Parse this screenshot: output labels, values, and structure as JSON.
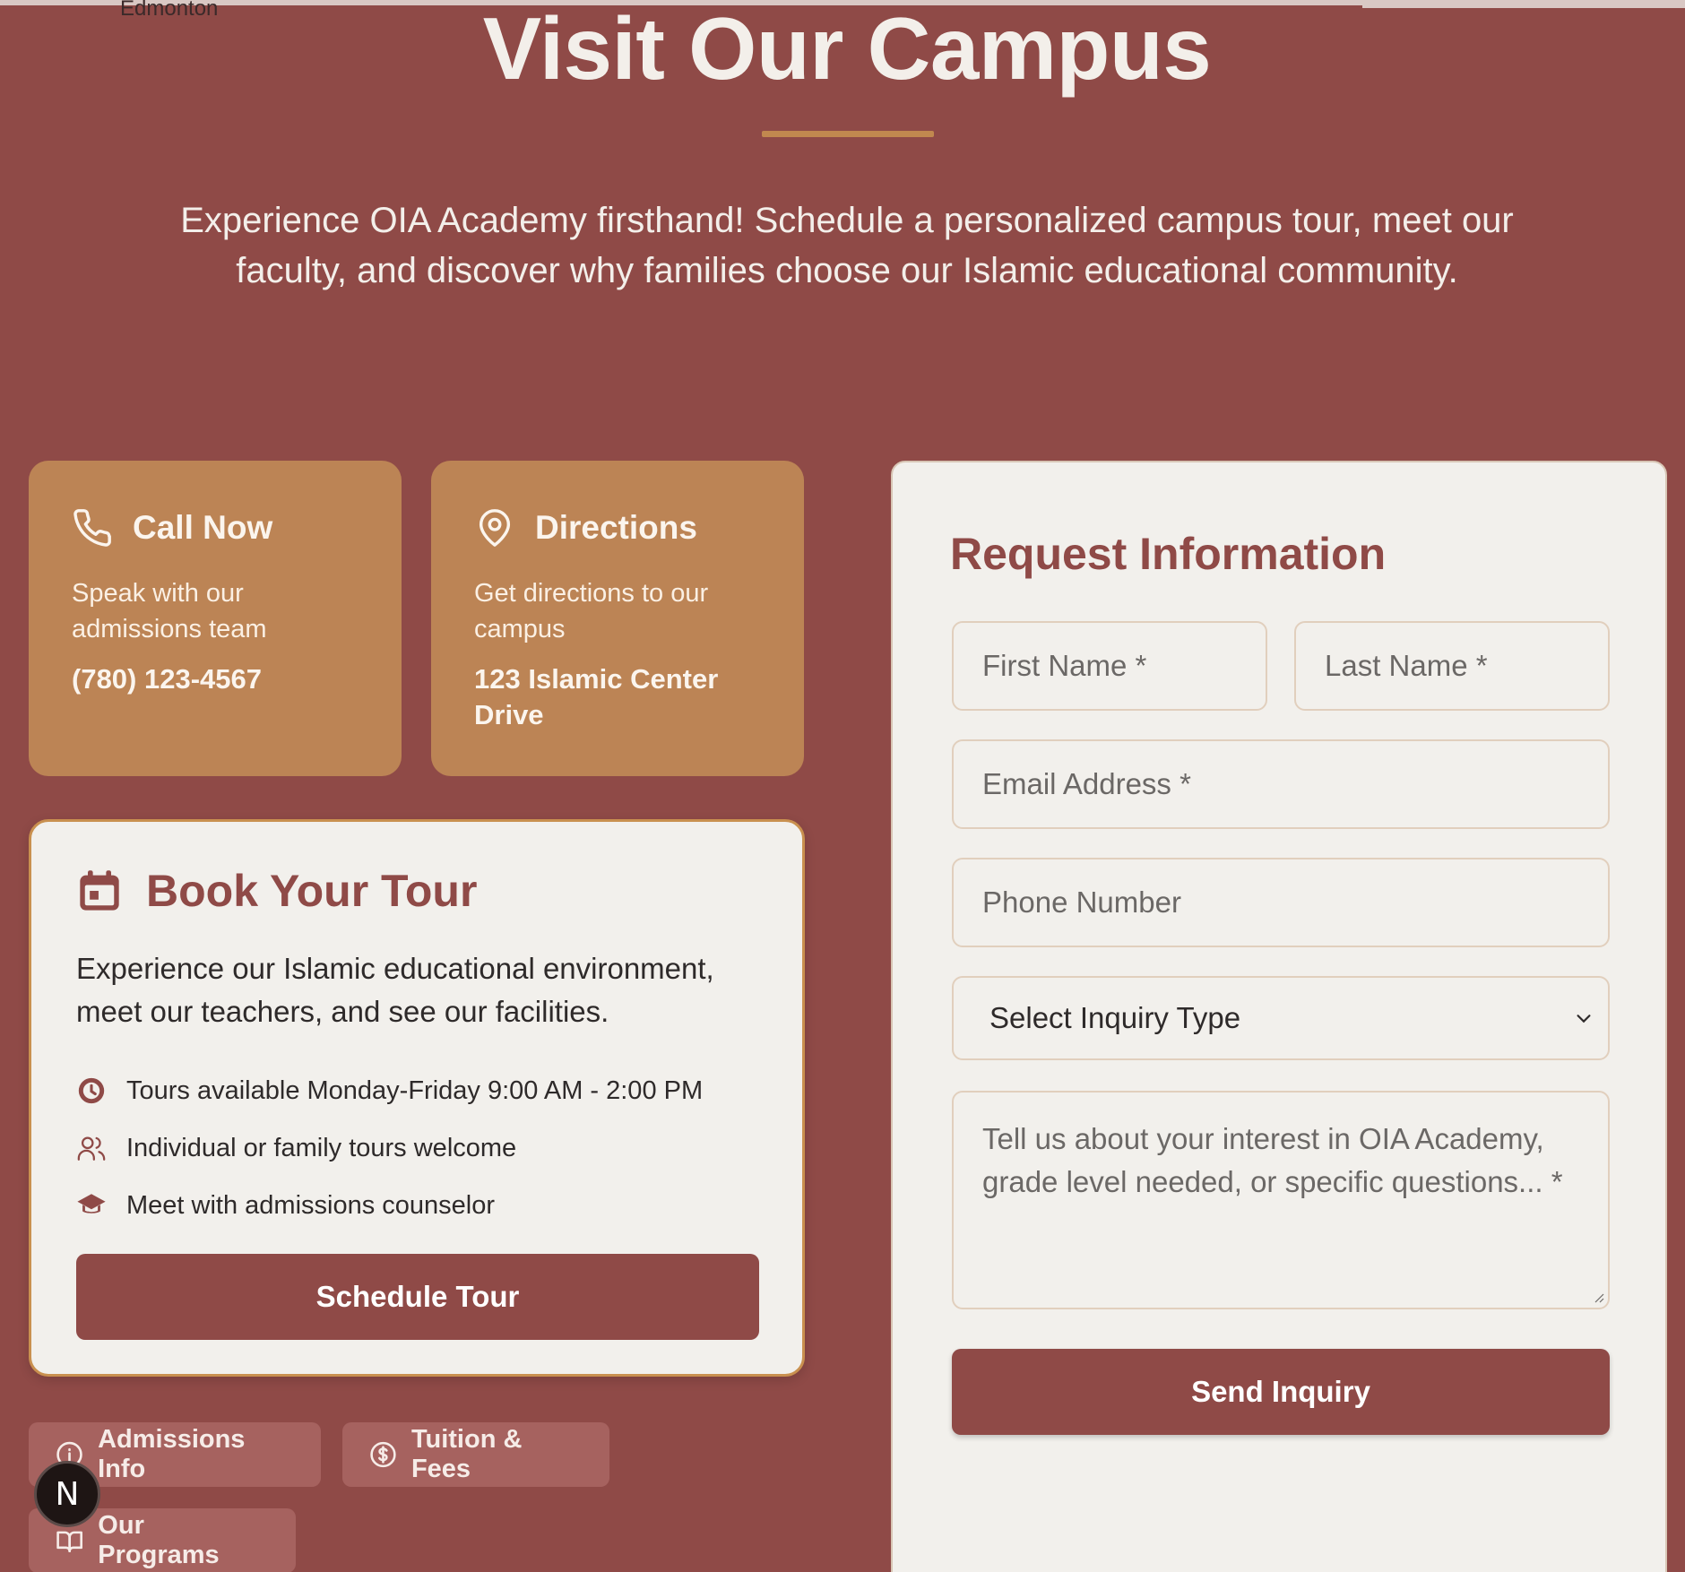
{
  "top": {
    "city": "Edmonton"
  },
  "hero": {
    "title": "Visit Our Campus",
    "subtitle": "Experience OIA Academy firsthand! Schedule a personalized campus tour, meet our faculty, and discover why families choose our Islamic educational community."
  },
  "contact_cards": {
    "call": {
      "title": "Call Now",
      "description": "Speak with our admissions team",
      "value": "(780) 123-4567",
      "icon": "phone-icon"
    },
    "directions": {
      "title": "Directions",
      "description": "Get directions to our campus",
      "value": "123 Islamic Center Drive",
      "icon": "map-pin-icon"
    }
  },
  "book_tour": {
    "title": "Book Your Tour",
    "description": "Experience our Islamic educational environment, meet our teachers, and see our facilities.",
    "features": [
      {
        "text": "Tours available Monday-Friday 9:00 AM - 2:00 PM",
        "icon": "clock-icon"
      },
      {
        "text": "Individual or family tours welcome",
        "icon": "users-icon"
      },
      {
        "text": "Meet with admissions counselor",
        "icon": "graduation-cap-icon"
      }
    ],
    "button": "Schedule Tour"
  },
  "quick_links": [
    {
      "label": "Admissions Info",
      "icon": "info-icon"
    },
    {
      "label": "Tuition & Fees",
      "icon": "dollar-icon"
    },
    {
      "label": "Our Programs",
      "icon": "book-icon"
    }
  ],
  "badge": {
    "letter": "N"
  },
  "form": {
    "title": "Request Information",
    "first_name_placeholder": "First Name *",
    "last_name_placeholder": "Last Name *",
    "email_placeholder": "Email Address *",
    "phone_placeholder": "Phone Number",
    "inquiry_select": "Select Inquiry Type",
    "message_placeholder": "Tell us about your interest in OIA Academy, grade level needed, or specific questions... *",
    "submit": "Send Inquiry"
  },
  "colors": {
    "primary": "#8f4a47",
    "accent": "#bc8455",
    "card": "#f2f0ec"
  }
}
